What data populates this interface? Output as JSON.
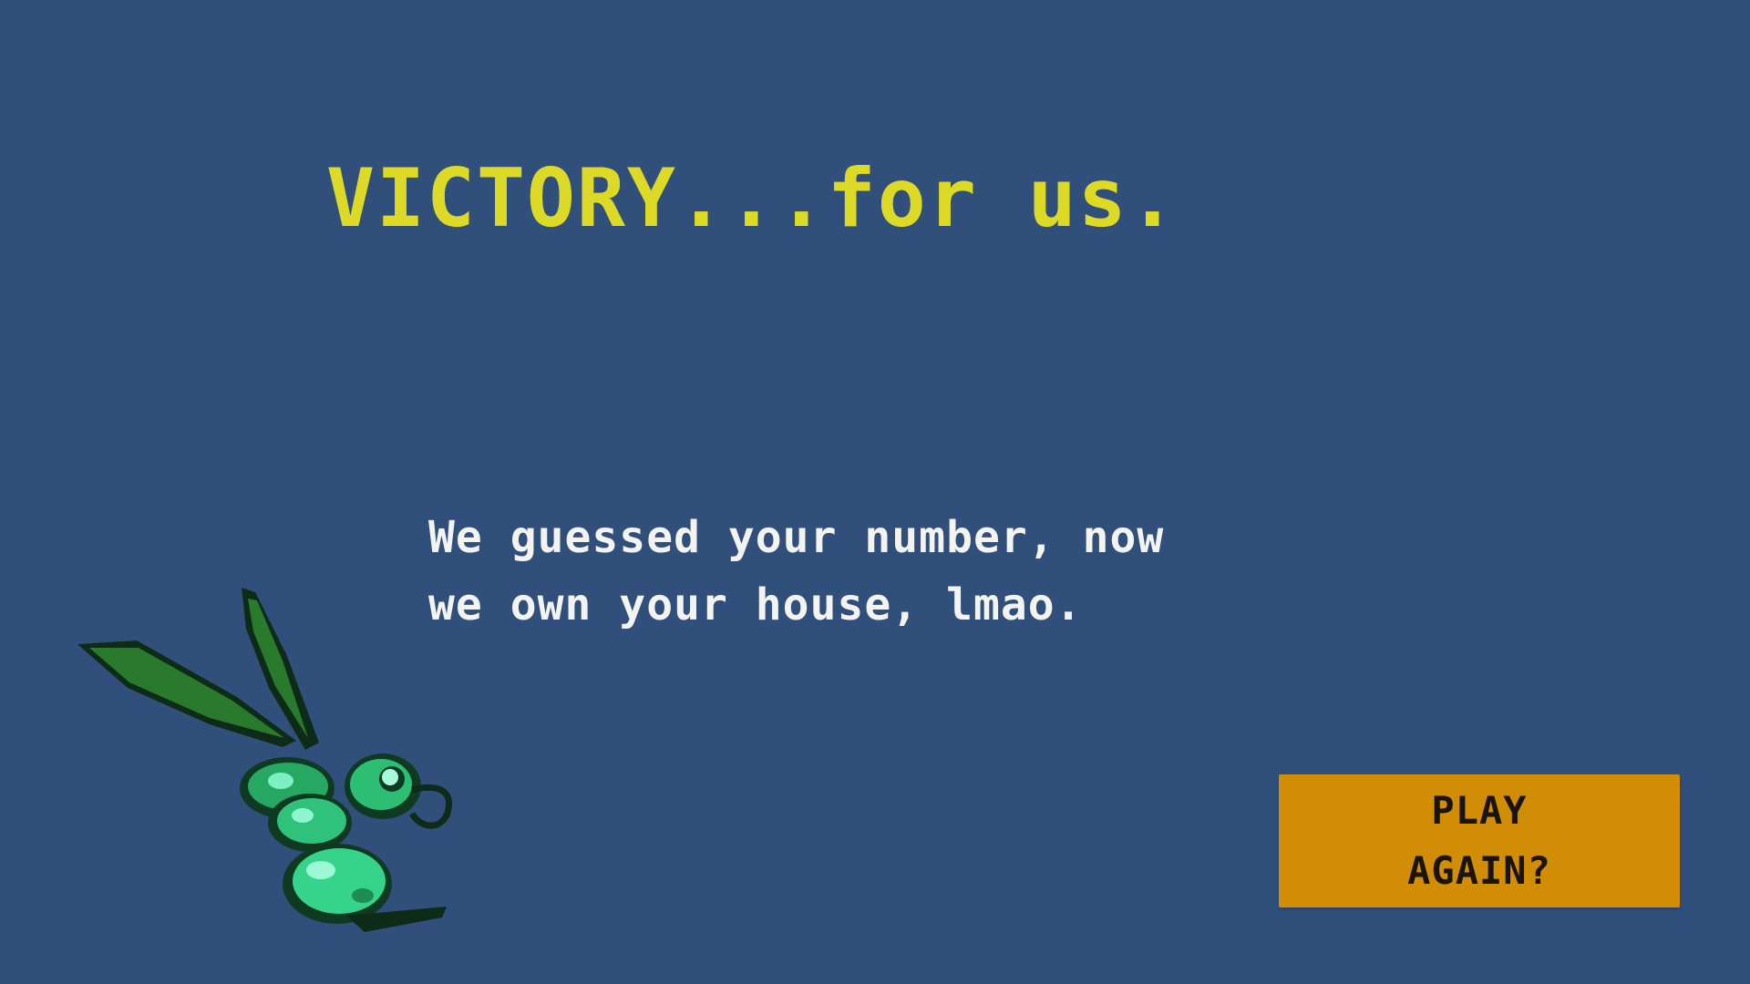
{
  "screen": {
    "background_color": "#314f7b",
    "title": "VICTORY...for us.",
    "title_color": "#ddd927",
    "message_lines": [
      "We guessed your number, now",
      "we own your house, lmao."
    ],
    "message_color": "#f3f3f0"
  },
  "play_again_button": {
    "label_lines": [
      "PLAY",
      "AGAIN?"
    ],
    "background_color": "#d18d06",
    "text_color": "#1a1410"
  },
  "sprite": {
    "icon": "green-dragonfly-bug-icon",
    "colors": [
      "#2a7a2e",
      "#36d48a",
      "#0f3a22"
    ]
  }
}
